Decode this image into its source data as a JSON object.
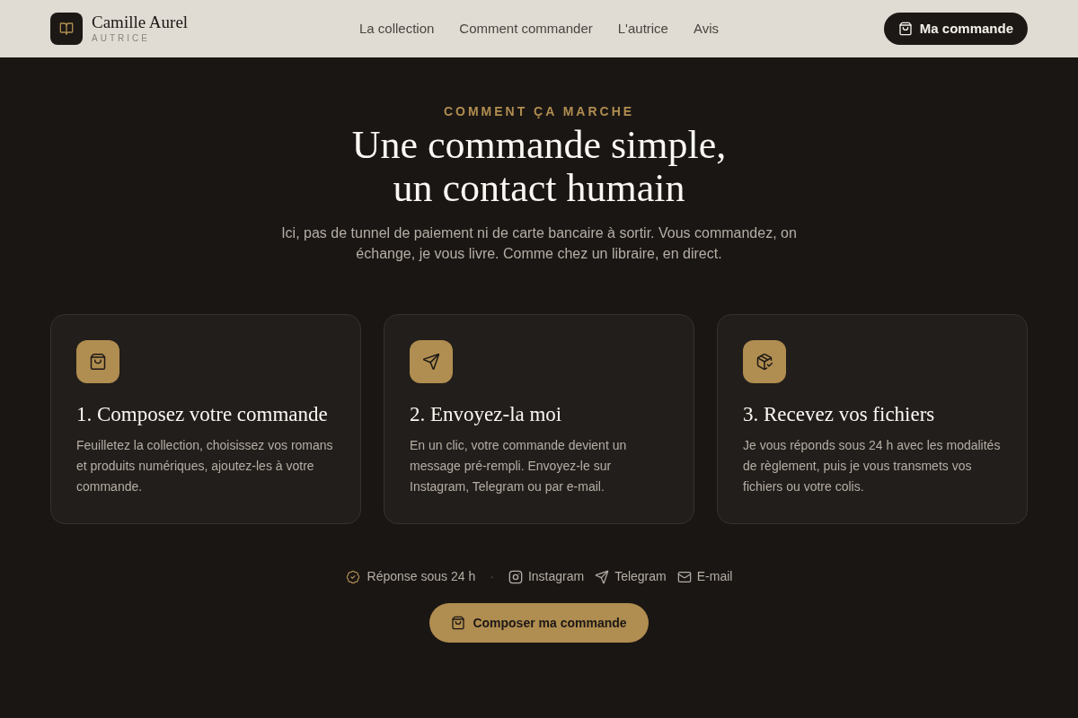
{
  "header": {
    "brand": {
      "name": "Camille Aurel",
      "subtitle": "AUTRICE"
    },
    "nav": [
      {
        "label": "La collection"
      },
      {
        "label": "Comment commander"
      },
      {
        "label": "L'autrice"
      },
      {
        "label": "Avis"
      }
    ],
    "cta": {
      "label": "Ma commande"
    }
  },
  "section": {
    "eyebrow": "COMMENT ÇA MARCHE",
    "title_lines": [
      "Une commande simple,",
      "un contact humain"
    ],
    "intro": "Ici, pas de tunnel de paiement ni de carte bancaire à sortir. Vous commandez, on échange, je vous livre. Comme chez un libraire, en direct.",
    "steps": [
      {
        "kind": "bag",
        "title": "1. Composez votre commande",
        "text": "Feuilletez la collection, choisissez vos romans et produits numériques, ajoutez-les à votre commande."
      },
      {
        "kind": "send",
        "title": "2. Envoyez-la moi",
        "text": "En un clic, votre commande devient un message pré-rempli. Envoyez-le sur Instagram, Telegram ou par e-mail."
      },
      {
        "kind": "package",
        "title": "3. Recevez vos fichiers",
        "text": "Je vous réponds sous 24 h avec les modalités de règlement, puis je vous transmets vos fichiers ou votre colis."
      }
    ],
    "contacts": [
      {
        "kind": "badge",
        "label": "Réponse sous 24 h"
      },
      {
        "kind": "separator",
        "label": "·"
      },
      {
        "kind": "instagram",
        "label": "Instagram"
      },
      {
        "kind": "telegram",
        "label": "Telegram"
      },
      {
        "kind": "email",
        "label": "E-mail"
      }
    ],
    "button": {
      "label": "Composer ma commande"
    }
  }
}
